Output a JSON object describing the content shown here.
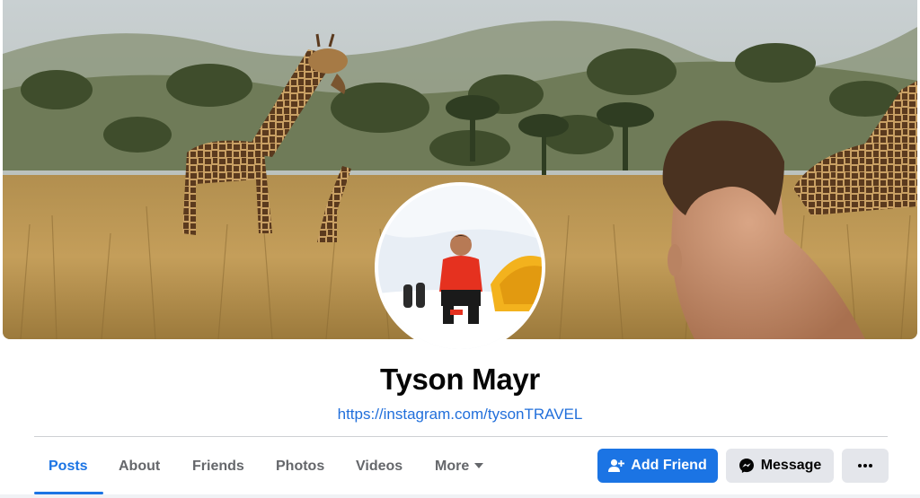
{
  "profile": {
    "name": "Tyson Mayr",
    "link": "https://instagram.com/tysonTRAVEL"
  },
  "tabs": [
    {
      "label": "Posts",
      "active": true
    },
    {
      "label": "About"
    },
    {
      "label": "Friends"
    },
    {
      "label": "Photos"
    },
    {
      "label": "Videos"
    },
    {
      "label": "More"
    }
  ],
  "actions": {
    "add_friend": "Add Friend",
    "message": "Message",
    "more_icon": "ellipsis-icon"
  },
  "colors": {
    "accent": "#1b74e4",
    "link": "#216fdb",
    "secondary_button": "#e4e6eb",
    "muted_text": "#65676b"
  }
}
